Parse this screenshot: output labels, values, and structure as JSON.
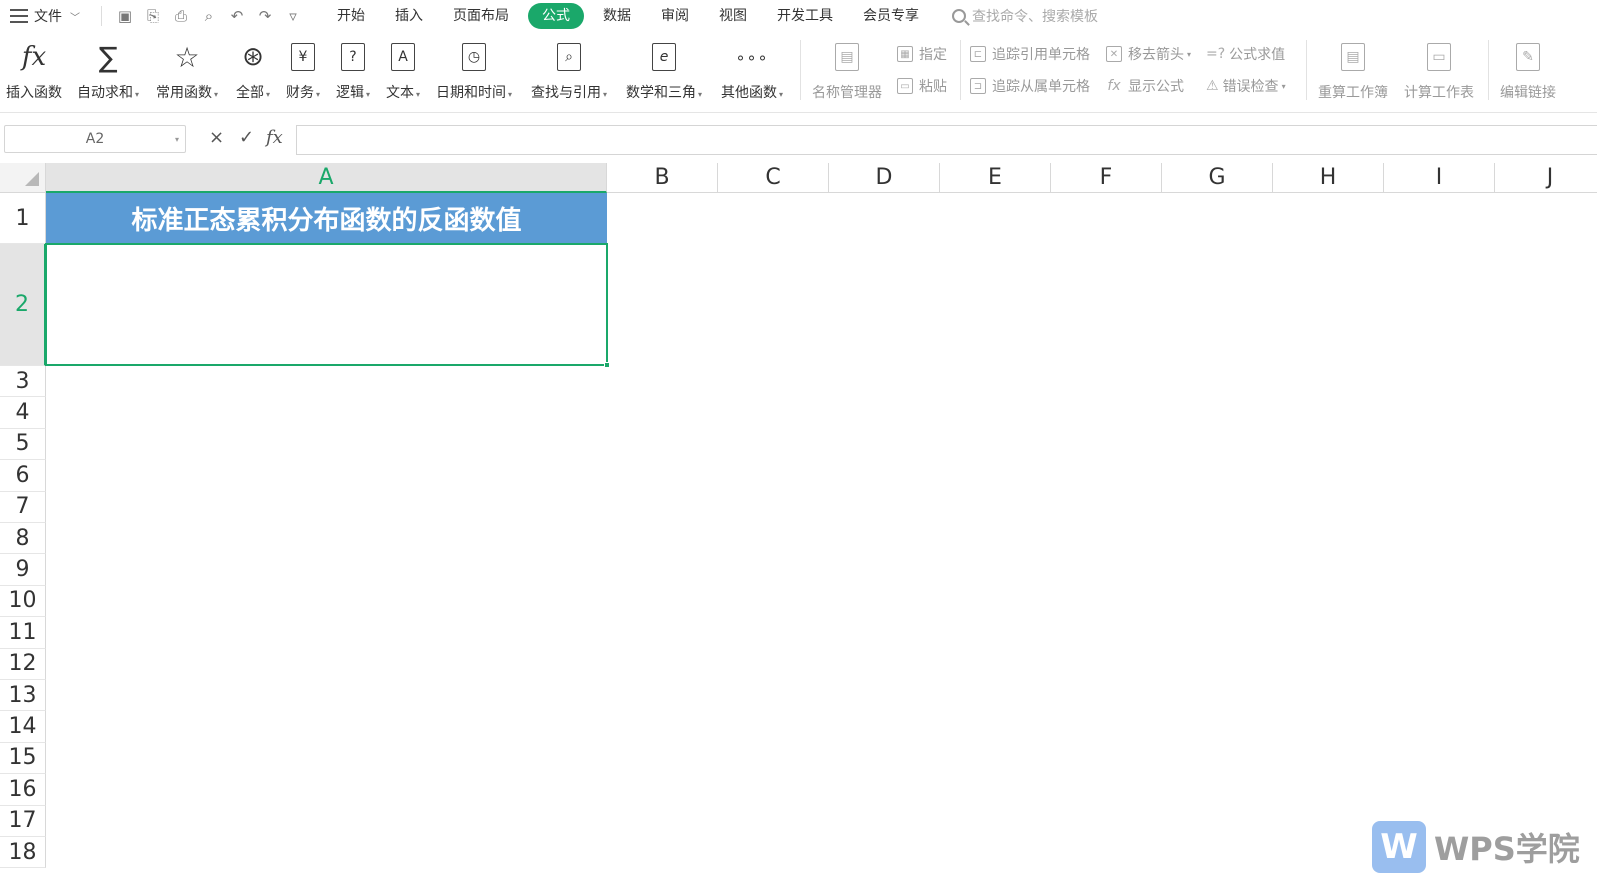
{
  "menubar": {
    "file_label": "文件",
    "menus": [
      {
        "label": "开始",
        "active": false
      },
      {
        "label": "插入",
        "active": false
      },
      {
        "label": "页面布局",
        "active": false
      },
      {
        "label": "公式",
        "active": true
      },
      {
        "label": "数据",
        "active": false
      },
      {
        "label": "审阅",
        "active": false
      },
      {
        "label": "视图",
        "active": false
      },
      {
        "label": "开发工具",
        "active": false
      },
      {
        "label": "会员专享",
        "active": false
      }
    ],
    "search_placeholder": "查找命令、搜索模板"
  },
  "ribbon": {
    "insert_function": "插入函数",
    "autosum": "自动求和",
    "common_functions": "常用函数",
    "all": "全部",
    "finance": "财务",
    "logic": "逻辑",
    "text": "文本",
    "datetime": "日期和时间",
    "lookup": "查找与引用",
    "math": "数学和三角",
    "other": "其他函数",
    "name_manager": "名称管理器",
    "specify": "指定",
    "paste": "粘贴",
    "trace_precedents": "追踪引用单元格",
    "trace_dependents": "追踪从属单元格",
    "remove_arrows": "移去箭头",
    "show_formulas": "显示公式",
    "evaluate_formula": "公式求值",
    "error_check": "错误检查",
    "recalc_workbook": "重算工作簿",
    "calc_sheet": "计算工作表",
    "edit_links": "编辑链接",
    "fx_glyph": "fx",
    "sum_glyph": "∑",
    "star_glyph": "☆",
    "all_glyph": "⊛",
    "yen_glyph": "¥",
    "question_glyph": "?",
    "a_glyph": "A",
    "e_glyph": "e",
    "dots_glyph": "∘∘∘"
  },
  "formula_bar": {
    "name_box": "A2",
    "cancel": "×",
    "confirm": "✓",
    "fx": "fx",
    "value": ""
  },
  "grid": {
    "columns": [
      "A",
      "B",
      "C",
      "D",
      "E",
      "F",
      "G",
      "H",
      "I",
      "J"
    ],
    "rows": [
      "1",
      "2",
      "3",
      "4",
      "5",
      "6",
      "7",
      "8",
      "9",
      "10",
      "11",
      "12",
      "13",
      "14",
      "15",
      "16",
      "17",
      "18"
    ],
    "selected_col": "A",
    "selected_row": "2",
    "cell_a1": "标准正态累积分布函数的反函数值",
    "cell_a2": ""
  },
  "watermark": {
    "logo_letter": "W",
    "text": "WPS学院"
  },
  "colors": {
    "accent": "#1aa86a",
    "header_fill": "#5b9bd5"
  }
}
